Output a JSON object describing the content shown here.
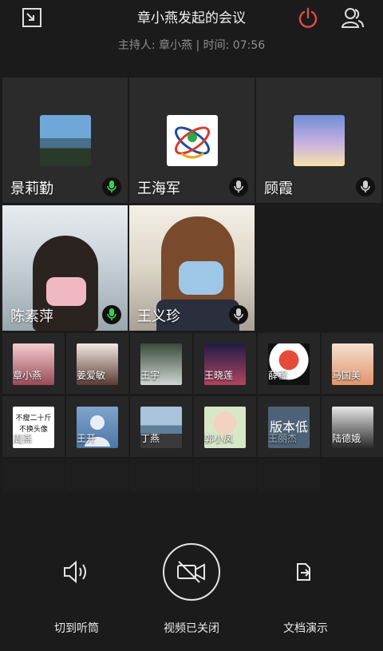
{
  "header": {
    "title": "章小燕发起的会议",
    "subtitle": "主持人: 章小燕 | 时间: 07:56",
    "icons": [
      "minimize-icon",
      "power-icon",
      "participants-icon"
    ],
    "power_color": "#e14b4b"
  },
  "participants_main": [
    {
      "name": "景莉勤",
      "mic": "active"
    },
    {
      "name": "王海军",
      "mic": "muted"
    },
    {
      "name": "顾霞",
      "mic": "muted"
    },
    {
      "name": "陈素萍",
      "mic": "active"
    },
    {
      "name": "王义珍",
      "mic": "muted"
    }
  ],
  "participants_grid": [
    {
      "name": "章小燕"
    },
    {
      "name": "姜爱敏"
    },
    {
      "name": "王宇"
    },
    {
      "name": "王晓莲"
    },
    {
      "name": "薛程"
    },
    {
      "name": "马国美"
    },
    {
      "name": "周燕",
      "thumb_text": "不瘦二十斤 不换头像"
    },
    {
      "name": "王开"
    },
    {
      "name": "丁燕"
    },
    {
      "name": "郭小凤"
    },
    {
      "name": "王丽杰",
      "thumb_text": "版本低"
    },
    {
      "name": "陆德娥"
    }
  ],
  "controls": {
    "speaker_label": "切到听筒",
    "video_label": "视频已关闭",
    "share_label": "文档演示"
  },
  "colors": {
    "active_mic": "#3ccf4e",
    "muted_mic": "#cfcfcf"
  }
}
